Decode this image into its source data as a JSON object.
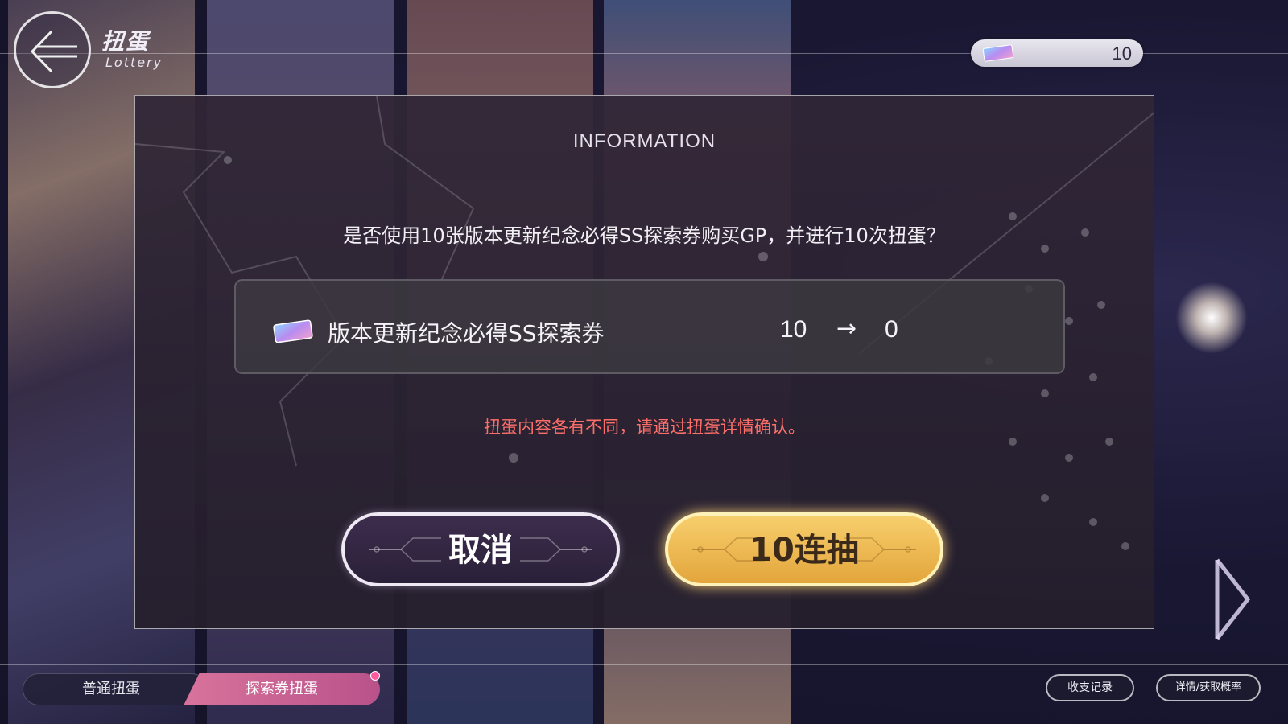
{
  "header": {
    "title": "扭蛋",
    "subtitle": "Lottery"
  },
  "currency": {
    "count": "10",
    "icon": "ticket-icon"
  },
  "dialog": {
    "title": "INFORMATION",
    "question": "是否使用10张版本更新纪念必得SS探索券购买GP，并进行10次扭蛋？",
    "item": {
      "name": "版本更新纪念必得SS探索券",
      "from": "10",
      "arrow": "→",
      "to": "0",
      "icon": "ticket-icon"
    },
    "warning": "扭蛋内容各有不同，请通过扭蛋详情确认。",
    "cancel_label": "取消",
    "confirm_label": "10连抽"
  },
  "tabs": {
    "normal": "普通扭蛋",
    "explore": "探索券扭蛋"
  },
  "footer": {
    "history": "收支记录",
    "details": "详情/获取概率"
  },
  "colors": {
    "confirm": "#f2c35b",
    "warning": "#ff6f6a",
    "active_tab": "#d8739c"
  }
}
